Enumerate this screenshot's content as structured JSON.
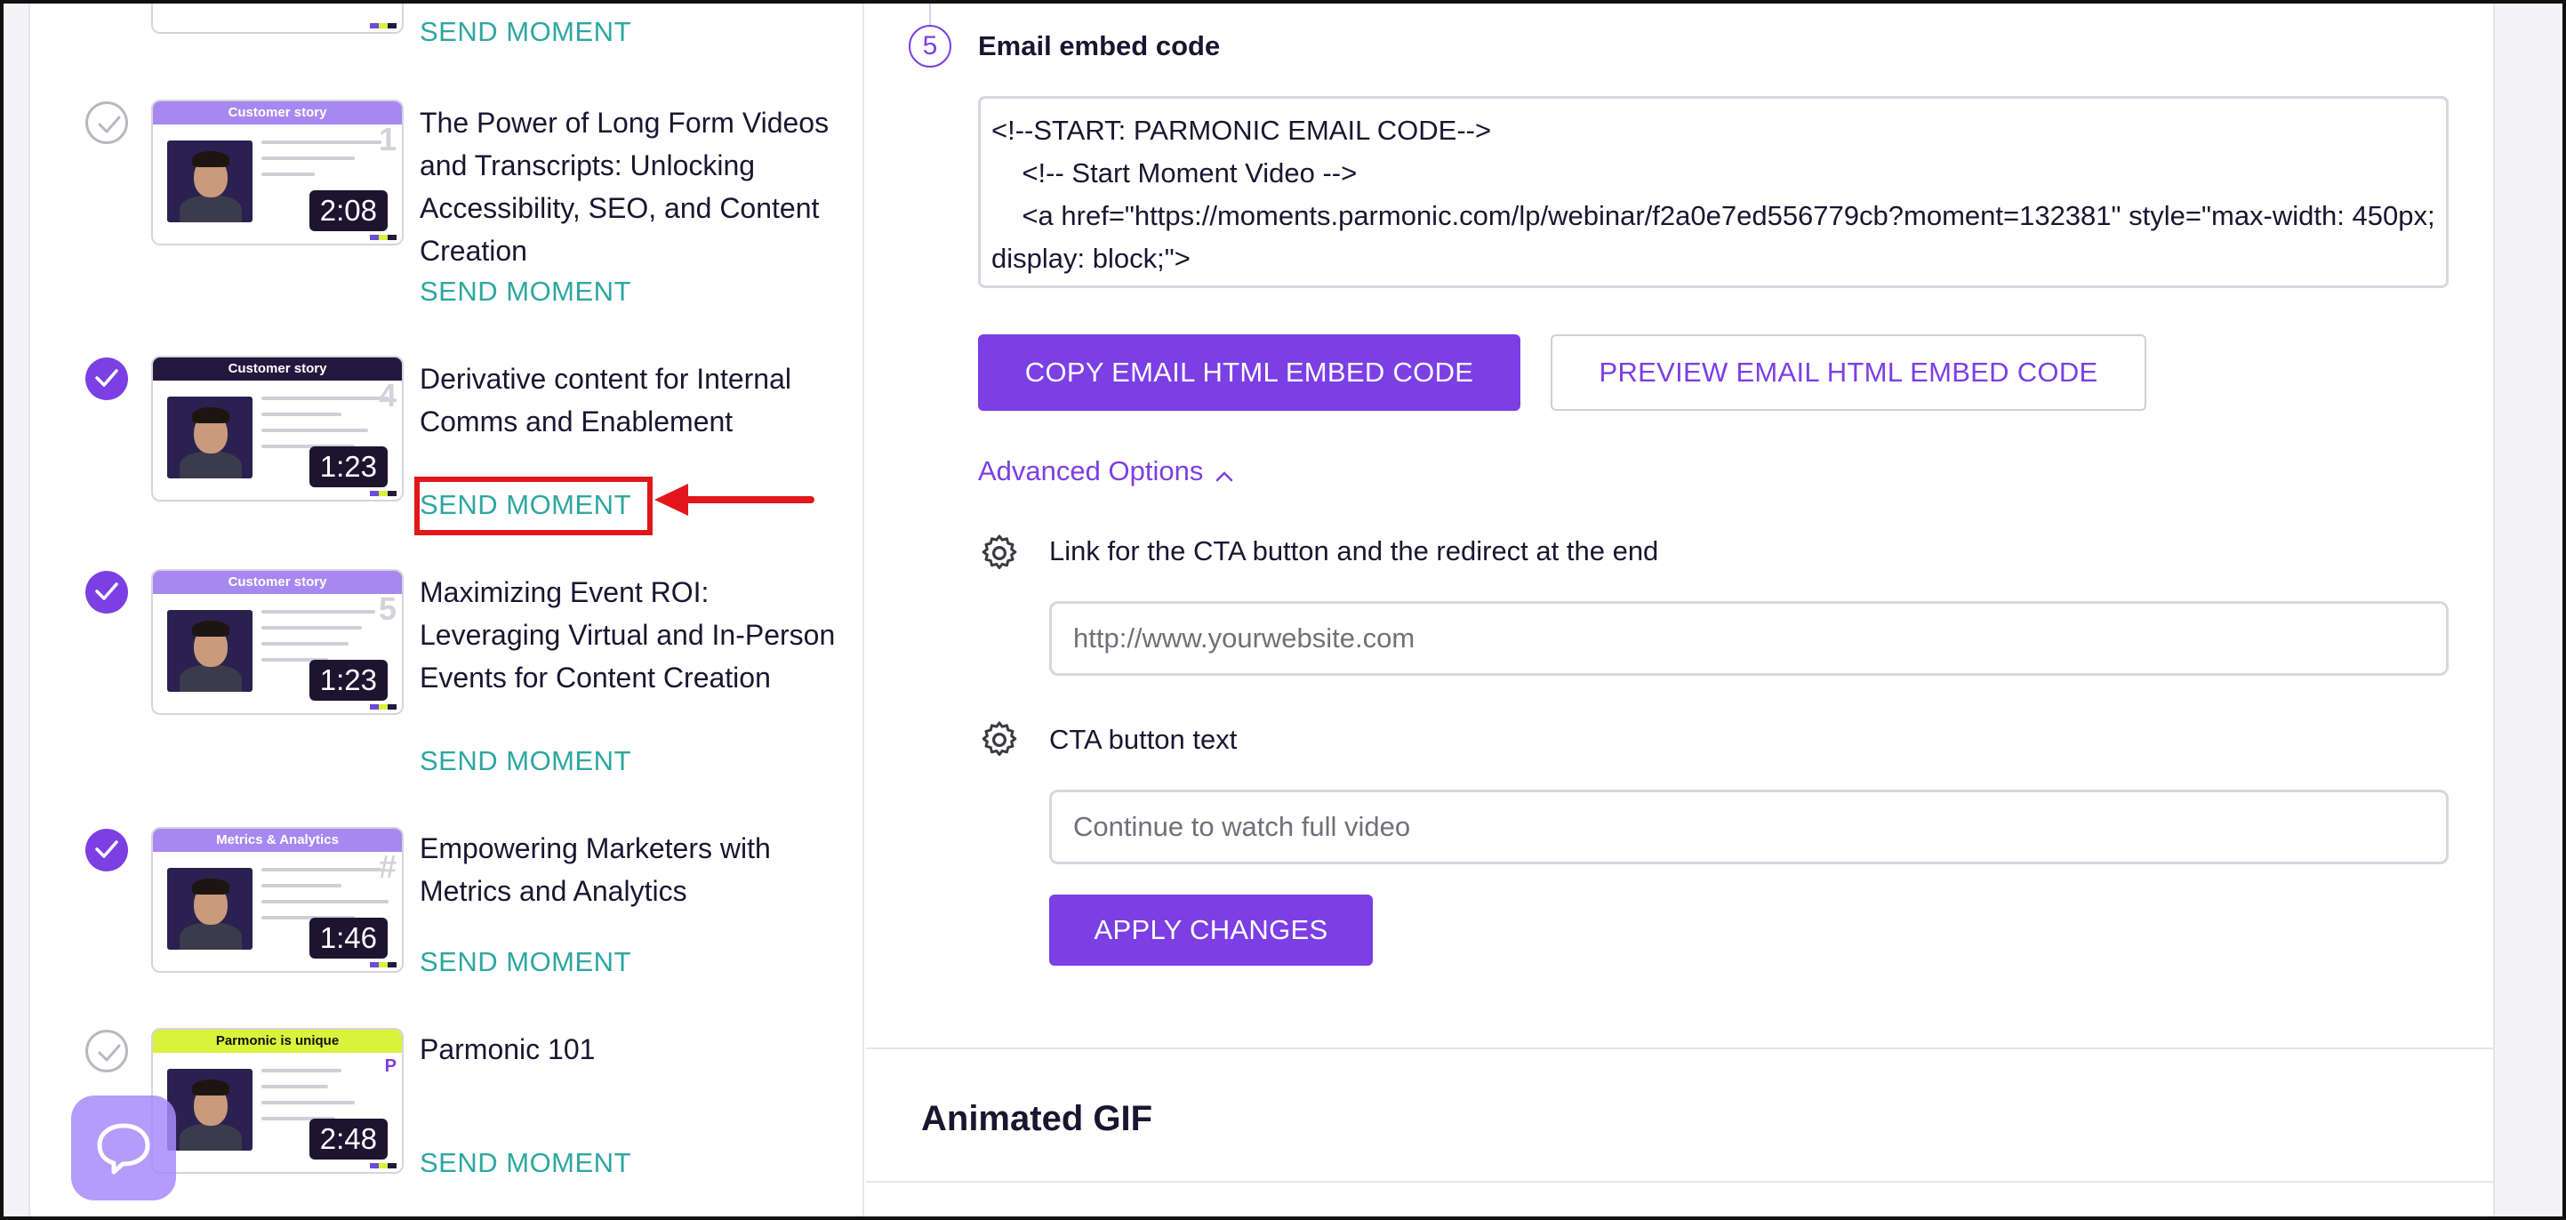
{
  "moments": [
    {
      "title": "",
      "duration": "",
      "band": "",
      "number": "",
      "send_label": "SEND MOMENT",
      "checked": false
    },
    {
      "title": "The Power of Long Form Videos and Transcripts: Unlocking Accessibility, SEO, and Content Creation",
      "duration": "2:08",
      "band": "Customer story",
      "number": "1",
      "send_label": "SEND MOMENT",
      "checked": false
    },
    {
      "title": "Derivative content for Internal Comms and Enablement",
      "duration": "1:23",
      "band": "Customer story",
      "number": "4",
      "send_label": "SEND MOMENT",
      "checked": true
    },
    {
      "title": "Maximizing Event ROI: Leveraging Virtual and In-Person Events for Content Creation",
      "duration": "1:23",
      "band": "Customer story",
      "number": "5",
      "send_label": "SEND MOMENT",
      "checked": true
    },
    {
      "title": "Empowering Marketers with Metrics and Analytics",
      "duration": "1:46",
      "band": "Metrics & Analytics",
      "number": "#",
      "send_label": "SEND MOMENT",
      "checked": true
    },
    {
      "title": "Parmonic 101",
      "duration": "2:48",
      "band": "Parmonic is unique",
      "number": "P",
      "send_label": "SEND MOMENT",
      "checked": false
    }
  ],
  "email_embed": {
    "step_number": "5",
    "title": "Email embed code",
    "code": "<!--START: PARMONIC EMAIL CODE-->\n    <!-- Start Moment Video -->\n    <a href=\"https://moments.parmonic.com/lp/webinar/f2a0e7ed556779cb?moment=132381\" style=\"max-width: 450px; display: block;\">",
    "copy_button": "COPY EMAIL HTML EMBED CODE",
    "preview_button": "PREVIEW EMAIL HTML EMBED CODE"
  },
  "advanced": {
    "label": "Advanced Options",
    "cta_link_label": "Link for the CTA button and the redirect at the end",
    "cta_link_placeholder": "http://www.yourwebsite.com",
    "cta_text_label": "CTA button text",
    "cta_text_placeholder": "Continue to watch full video",
    "apply_button": "APPLY CHANGES"
  },
  "animated_gif": {
    "title": "Animated GIF"
  },
  "colors": {
    "accent": "#7b3fe4",
    "send_link": "#2da7a0",
    "highlight": "#e1171b"
  },
  "icons": {
    "check": "check-icon",
    "gear": "gear-icon",
    "chevron": "chevron-up-icon",
    "chat": "chat-icon",
    "arrow": "red-arrow"
  }
}
